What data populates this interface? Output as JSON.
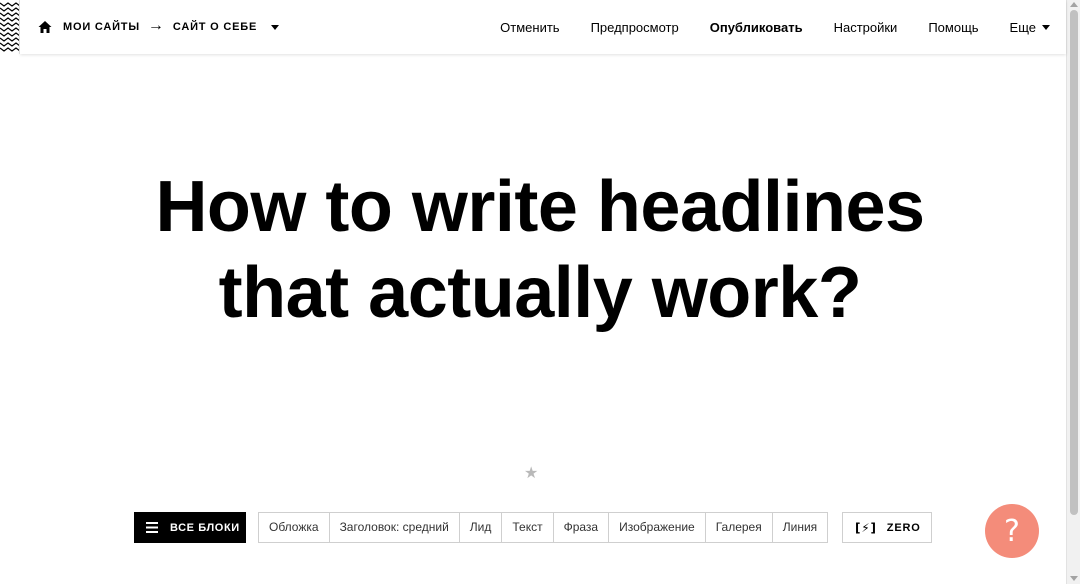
{
  "breadcrumb": {
    "sites_label": "Мои сайты",
    "arrow": "→",
    "page_label": "Сайт о себе"
  },
  "menu": {
    "cancel": "Отменить",
    "preview": "Предпросмотр",
    "publish": "Опубликовать",
    "settings": "Настройки",
    "help": "Помощь",
    "more": "Еще"
  },
  "headline": {
    "line1": "How to write headlines",
    "line2": "that actually work?"
  },
  "star": "★",
  "bottom_bar": {
    "all_blocks": "ВСЕ БЛОКИ",
    "block_types": [
      "Обложка",
      "Заголовок: средний",
      "Лид",
      "Текст",
      "Фраза",
      "Изображение",
      "Галерея",
      "Линия"
    ],
    "zero_icon": "[⚡]",
    "zero_label": "ZERO"
  },
  "help_button": "?",
  "colors": {
    "help_button_bg": "#f48c7a",
    "all_blocks_bg": "#000000"
  }
}
